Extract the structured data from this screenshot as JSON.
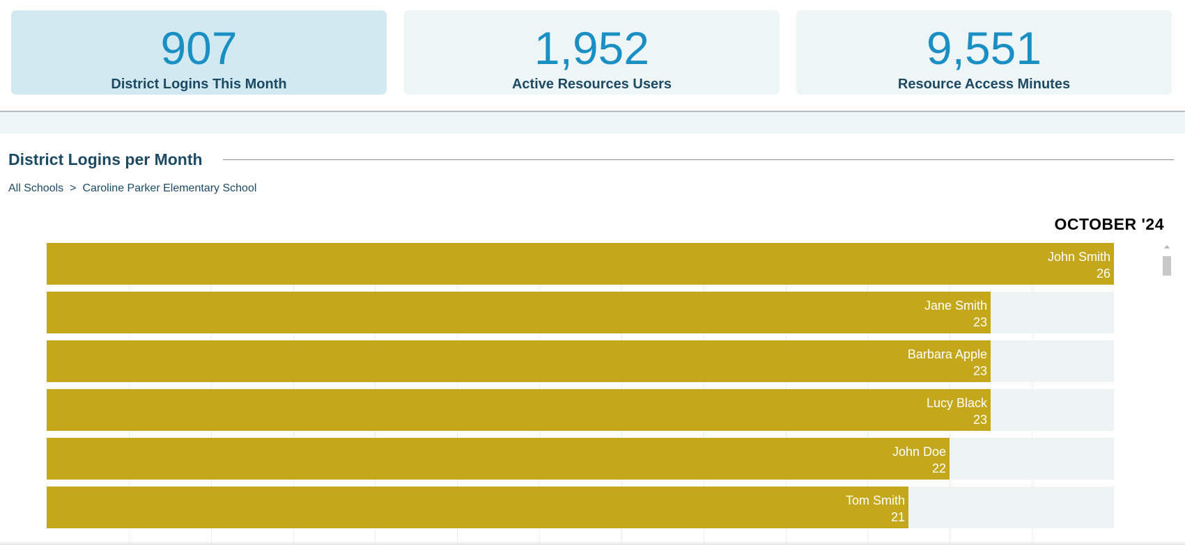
{
  "stats": [
    {
      "value": "907",
      "label": "District Logins This Month"
    },
    {
      "value": "1,952",
      "label": "Active Resources Users"
    },
    {
      "value": "9,551",
      "label": "Resource Access Minutes"
    }
  ],
  "section": {
    "title": "District Logins per Month"
  },
  "breadcrumb": {
    "root": "All Schools",
    "separator": ">",
    "current": "Caroline Parker Elementary School"
  },
  "chart_data": {
    "type": "bar",
    "orientation": "horizontal",
    "title": "OCTOBER '24",
    "categories": [
      "John Smith",
      "Jane Smith",
      "Barbara Apple",
      "Lucy Black",
      "John Doe",
      "Tom Smith"
    ],
    "values": [
      26,
      23,
      23,
      23,
      22,
      21
    ],
    "xlim": [
      0,
      26
    ],
    "bar_color": "#c4a71b",
    "grid": true
  },
  "colors": {
    "accent": "#1a8fc4",
    "heading": "#1c4a63",
    "bar": "#c4a71b"
  }
}
